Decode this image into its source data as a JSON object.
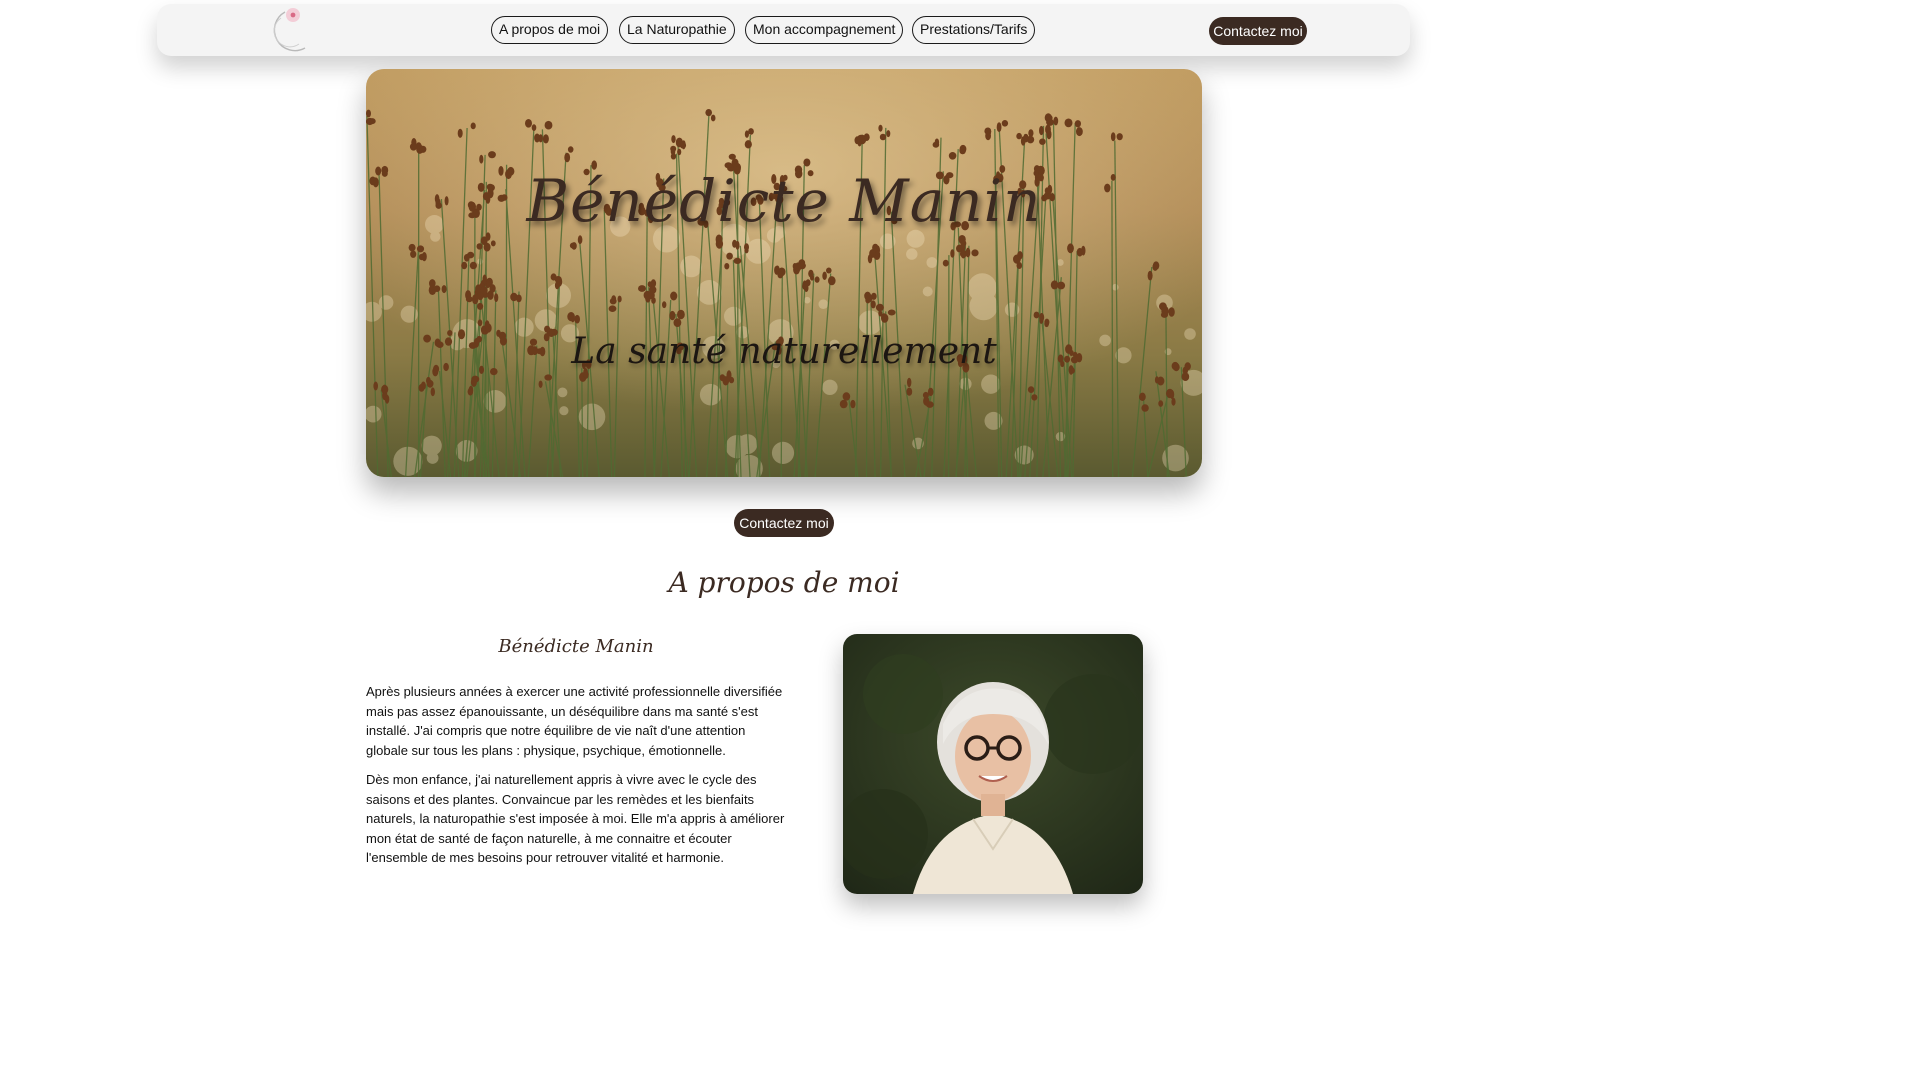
{
  "nav": {
    "items": [
      {
        "label": "A propos de moi"
      },
      {
        "label": "La Naturopathie"
      },
      {
        "label": "Mon accompagnement"
      },
      {
        "label": "Prestations/Tarifs"
      }
    ],
    "contact_label": "Contactez moi"
  },
  "hero": {
    "title": "Bénédicte Manin",
    "subtitle": "La santé naturellement"
  },
  "cta": {
    "label": "Contactez moi"
  },
  "about": {
    "title": "A propos de moi",
    "name": "Bénédicte Manin",
    "paragraphs": [
      "Après plusieurs années à exercer une activité professionnelle diversifiée mais pas assez épanouissante, un déséquilibre dans ma santé s'est installé. J'ai compris que notre équilibre de vie naît d'une attention globale sur tous les plans : physique, psychique, émotionnelle.",
      "Dès mon enfance, j'ai naturellement appris à vivre avec le cycle des saisons et des plantes. Convaincue par les remèdes et les bienfaits naturels, la naturopathie s'est imposée à moi. Elle m'a appris à améliorer mon état de santé de façon naturelle, à me connaitre et écouter l'ensemble de mes besoins pour retrouver vitalité et harmonie."
    ]
  },
  "colors": {
    "brand_dark": "#3b2a22",
    "nav_background": "#f4f4f4",
    "logo_accent": "#e8a3b4"
  },
  "icons": {
    "logo": "circle-flower-logo-icon"
  }
}
